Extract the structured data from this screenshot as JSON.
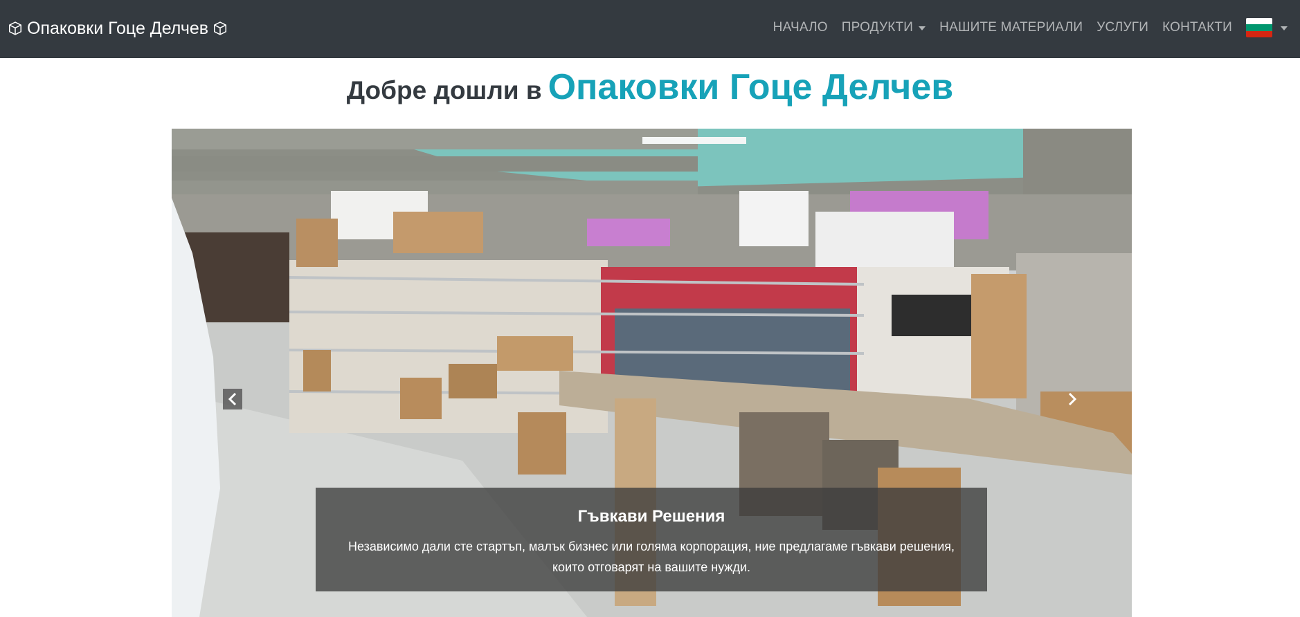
{
  "navbar": {
    "brand": "Опаковки Гоце Делчев",
    "brand_icon": "box-icon",
    "links": {
      "home": "НАЧАЛО",
      "products": "ПРОДУКТИ",
      "materials": "НАШИТЕ МАТЕРИАЛИ",
      "services": "УСЛУГИ",
      "contacts": "КОНТАКТИ"
    },
    "language": {
      "icon": "bulgarian-flag-icon",
      "colors": [
        "#ffffff",
        "#00966e",
        "#d62612"
      ]
    }
  },
  "welcome": {
    "prefix": "Добре дошли в",
    "highlight": "Опаковки Гоце Делчев",
    "highlight_color": "#17a2b8"
  },
  "carousel": {
    "image": "warehouse-shelves-photo",
    "caption": {
      "title": "Гъвкави Решения",
      "text": "Независимо дали сте стартъп, малък бизнес или голяма корпорация, ние предлагаме гъвкави решения, които отговарят на вашите нужди."
    },
    "controls": {
      "prev_icon": "chevron-left-icon",
      "next_icon": "chevron-right-icon"
    }
  }
}
